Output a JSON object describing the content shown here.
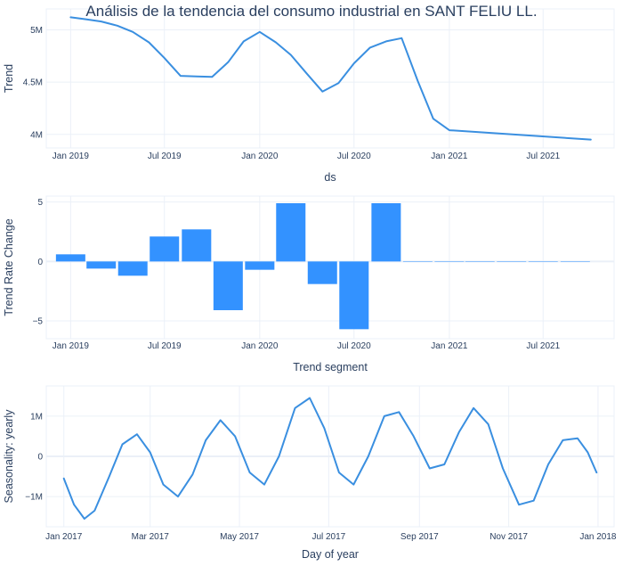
{
  "title": "Análisis de la tendencia del consumo industrial en SANT FELIU LL.",
  "colors": {
    "line": "#3a8fe0",
    "bar": "#3392ff",
    "text": "#2a3f5f",
    "grid": "#ebf0f8"
  },
  "chart_data": [
    {
      "type": "line",
      "title": "Análisis de la tendencia del consumo industrial en SANT FELIU LL.",
      "xlabel": "ds",
      "ylabel": "Trend",
      "x_ticks": [
        "Jan 2019",
        "Jul 2019",
        "Jan 2020",
        "Jul 2020",
        "Jan 2021",
        "Jul 2021"
      ],
      "x_tick_dates": [
        "2019-01-01",
        "2019-07-01",
        "2020-01-01",
        "2020-07-01",
        "2021-01-01",
        "2021-07-01"
      ],
      "xlim": [
        "2018-11-15",
        "2021-11-15"
      ],
      "y_ticks": [
        4000000,
        4500000,
        5000000
      ],
      "y_tick_labels": [
        "4M",
        "4.5M",
        "5M"
      ],
      "ylim": [
        3870000,
        5200000
      ],
      "grid": true,
      "series": [
        {
          "x": [
            "2019-01-01",
            "2019-02-01",
            "2019-03-01",
            "2019-04-01",
            "2019-05-01",
            "2019-06-01",
            "2019-07-01",
            "2019-08-01",
            "2019-09-01",
            "2019-10-01",
            "2019-11-01",
            "2019-12-01",
            "2020-01-01",
            "2020-02-01",
            "2020-03-01",
            "2020-04-01",
            "2020-05-01",
            "2020-06-01",
            "2020-07-01",
            "2020-08-01",
            "2020-09-01",
            "2020-10-01",
            "2020-11-01",
            "2020-12-01",
            "2021-01-01",
            "2021-10-01"
          ],
          "y": [
            5120000,
            5100000,
            5080000,
            5040000,
            4980000,
            4880000,
            4730000,
            4560000,
            4555000,
            4550000,
            4690000,
            4890000,
            4980000,
            4880000,
            4760000,
            4580000,
            4410000,
            4490000,
            4680000,
            4830000,
            4890000,
            4920000,
            4510000,
            4150000,
            4040000,
            3950000
          ]
        }
      ]
    },
    {
      "type": "bar",
      "xlabel": "Trend segment",
      "ylabel": "Trend Rate Change",
      "x_ticks": [
        "Jan 2019",
        "Jul 2019",
        "Jan 2020",
        "Jul 2020",
        "Jan 2021",
        "Jul 2021"
      ],
      "x_tick_dates": [
        "2019-01-01",
        "2019-07-01",
        "2020-01-01",
        "2020-07-01",
        "2021-01-01",
        "2021-07-01"
      ],
      "xlim": [
        "2018-11-15",
        "2021-11-15"
      ],
      "y_ticks": [
        -5,
        0,
        5
      ],
      "y_tick_labels": [
        "−5",
        "0",
        "5"
      ],
      "ylim": [
        -6.5,
        5.5
      ],
      "grid": true,
      "bars": [
        {
          "x": "2019-01-01",
          "value": 0.6
        },
        {
          "x": "2019-03-01",
          "value": -0.6
        },
        {
          "x": "2019-05-01",
          "value": -1.2
        },
        {
          "x": "2019-07-01",
          "value": 2.1
        },
        {
          "x": "2019-09-01",
          "value": 2.7
        },
        {
          "x": "2019-11-01",
          "value": -4.1
        },
        {
          "x": "2020-01-01",
          "value": -0.7
        },
        {
          "x": "2020-03-01",
          "value": 4.9
        },
        {
          "x": "2020-05-01",
          "value": -1.9
        },
        {
          "x": "2020-07-01",
          "value": -5.7
        },
        {
          "x": "2020-09-01",
          "value": 4.9
        },
        {
          "x": "2020-11-01",
          "value": 0.0
        },
        {
          "x": "2021-01-01",
          "value": 0.0
        },
        {
          "x": "2021-03-01",
          "value": 0.0
        },
        {
          "x": "2021-05-01",
          "value": 0.0
        },
        {
          "x": "2021-07-01",
          "value": 0.0
        },
        {
          "x": "2021-09-01",
          "value": 0.0
        }
      ]
    },
    {
      "type": "line",
      "xlabel": "Day of year",
      "ylabel": "Seasonality: yearly",
      "x_ticks": [
        "Jan 2017",
        "Mar 2017",
        "May 2017",
        "Jul 2017",
        "Sep 2017",
        "Nov 2017",
        "Jan 2018"
      ],
      "x_tick_dates": [
        "2017-01-01",
        "2017-03-01",
        "2017-05-01",
        "2017-07-01",
        "2017-09-01",
        "2017-11-01",
        "2018-01-01"
      ],
      "xlim": [
        "2016-12-20",
        "2018-01-12"
      ],
      "y_ticks": [
        -1000000,
        0,
        1000000
      ],
      "y_tick_labels": [
        "−1M",
        "0",
        "1M"
      ],
      "ylim": [
        -1750000,
        1750000
      ],
      "grid": true,
      "series": [
        {
          "x": [
            "2017-01-01",
            "2017-01-08",
            "2017-01-15",
            "2017-01-22",
            "2017-02-01",
            "2017-02-10",
            "2017-02-20",
            "2017-03-01",
            "2017-03-10",
            "2017-03-20",
            "2017-03-30",
            "2017-04-08",
            "2017-04-18",
            "2017-04-28",
            "2017-05-08",
            "2017-05-18",
            "2017-05-28",
            "2017-06-08",
            "2017-06-18",
            "2017-06-28",
            "2017-07-08",
            "2017-07-18",
            "2017-07-28",
            "2017-08-08",
            "2017-08-18",
            "2017-08-28",
            "2017-09-08",
            "2017-09-18",
            "2017-09-28",
            "2017-10-08",
            "2017-10-18",
            "2017-10-28",
            "2017-11-08",
            "2017-11-18",
            "2017-11-28",
            "2017-12-08",
            "2017-12-18",
            "2017-12-25",
            "2017-12-31"
          ],
          "y": [
            -550000,
            -1200000,
            -1550000,
            -1350000,
            -500000,
            300000,
            550000,
            100000,
            -700000,
            -1000000,
            -450000,
            400000,
            900000,
            500000,
            -400000,
            -700000,
            0,
            1200000,
            1450000,
            700000,
            -400000,
            -700000,
            0,
            1000000,
            1100000,
            500000,
            -300000,
            -200000,
            600000,
            1200000,
            800000,
            -300000,
            -1200000,
            -1100000,
            -200000,
            400000,
            450000,
            100000,
            -400000
          ]
        }
      ]
    }
  ]
}
